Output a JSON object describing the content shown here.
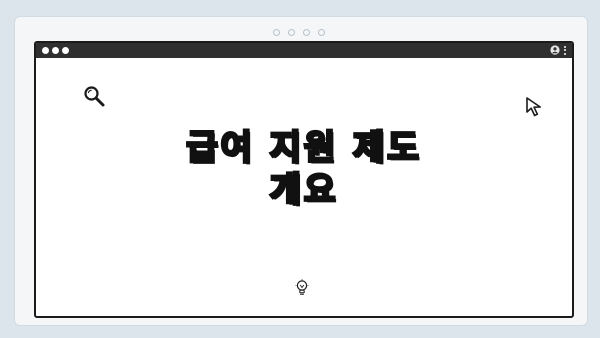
{
  "page": {
    "background": "#dde5ec",
    "card_background": "#f4f6f8",
    "window_border": "#1b1b1b",
    "titlebar_color": "#2f2f2f"
  },
  "window": {
    "titlebar": {
      "controls": [
        "close-dot",
        "minimize-dot",
        "maximize-dot"
      ],
      "right_icons": [
        "user-icon",
        "kebab-menu-icon"
      ]
    }
  },
  "content": {
    "title_line_1": "급여 지원 제도",
    "title_line_2": "개요",
    "icons": [
      "search-icon",
      "cursor-icon",
      "lightbulb-icon"
    ]
  }
}
